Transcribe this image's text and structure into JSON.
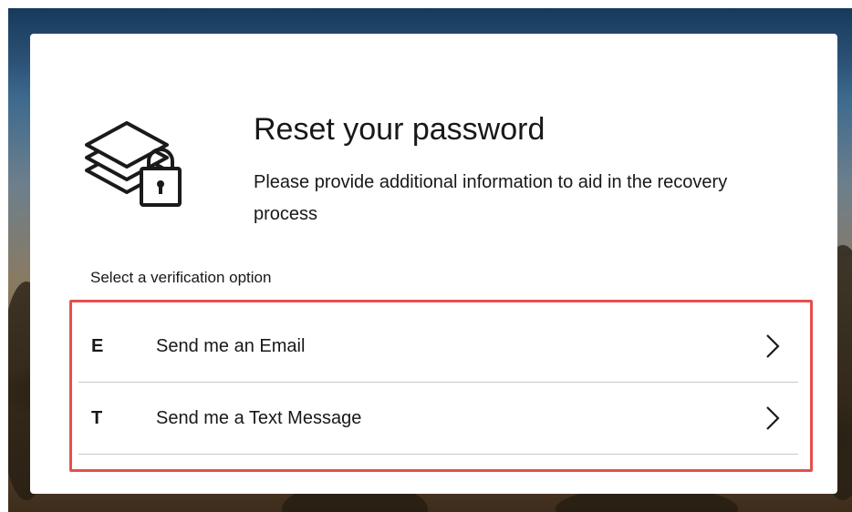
{
  "dialog": {
    "title": "Reset your password",
    "subtitle": "Please provide additional information to aid in the recovery process",
    "logo_icon": "stacked-papers-lock-icon"
  },
  "verification": {
    "prompt": "Select a verification option",
    "highlight_color": "#e4504f",
    "options": [
      {
        "key": "E",
        "label": "Send me an Email",
        "icon": "chevron-right-icon"
      },
      {
        "key": "T",
        "label": "Send me a Text Message",
        "icon": "chevron-right-icon"
      }
    ]
  }
}
